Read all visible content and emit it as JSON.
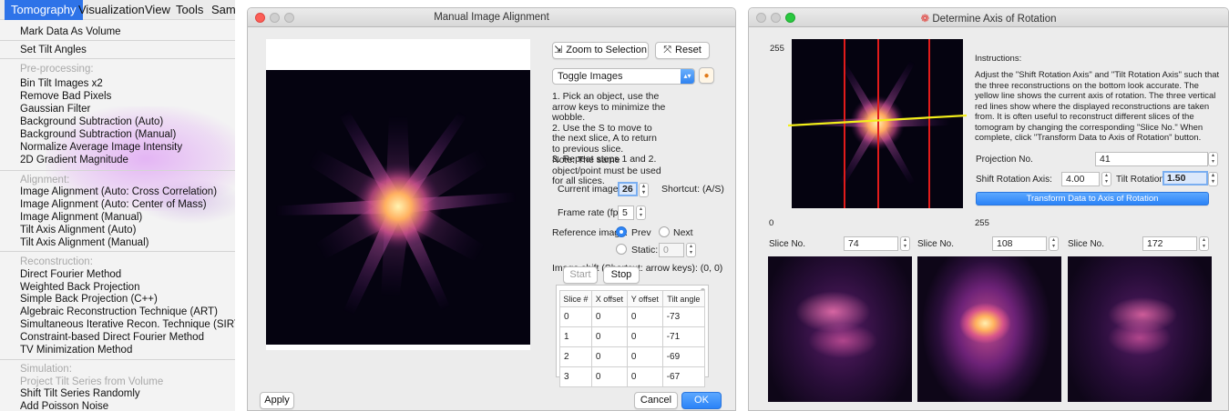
{
  "menu": {
    "menubar": [
      "Tomography",
      "Visualization",
      "View",
      "Tools",
      "Samp"
    ],
    "items": [
      {
        "label": "Mark Data As Volume",
        "type": "item"
      },
      {
        "label": "Set Tilt Angles",
        "type": "item"
      },
      {
        "label": "Pre-processing:",
        "type": "header"
      },
      {
        "label": "Bin Tilt Images x2",
        "type": "item"
      },
      {
        "label": "Remove Bad Pixels",
        "type": "item"
      },
      {
        "label": "Gaussian Filter",
        "type": "item"
      },
      {
        "label": "Background Subtraction (Auto)",
        "type": "item"
      },
      {
        "label": "Background Subtraction (Manual)",
        "type": "item"
      },
      {
        "label": "Normalize Average Image Intensity",
        "type": "item"
      },
      {
        "label": "2D Gradient Magnitude",
        "type": "item"
      },
      {
        "label": "Alignment:",
        "type": "header"
      },
      {
        "label": "Image Alignment (Auto: Cross Correlation)",
        "type": "item"
      },
      {
        "label": "Image Alignment (Auto: Center of Mass)",
        "type": "item"
      },
      {
        "label": "Image Alignment (Manual)",
        "type": "item"
      },
      {
        "label": "Tilt Axis Alignment (Auto)",
        "type": "item"
      },
      {
        "label": "Tilt Axis Alignment (Manual)",
        "type": "item"
      },
      {
        "label": "Reconstruction:",
        "type": "header"
      },
      {
        "label": "Direct Fourier Method",
        "type": "item"
      },
      {
        "label": "Weighted Back Projection",
        "type": "item"
      },
      {
        "label": "Simple Back Projection (C++)",
        "type": "item"
      },
      {
        "label": "Algebraic Reconstruction Technique (ART)",
        "type": "item"
      },
      {
        "label": "Simultaneous Iterative Recon. Technique (SIRT)",
        "type": "item"
      },
      {
        "label": "Constraint-based Direct Fourier Method",
        "type": "item"
      },
      {
        "label": "TV Minimization Method",
        "type": "item"
      },
      {
        "label": "Simulation:",
        "type": "header"
      },
      {
        "label": "Project Tilt Series from Volume",
        "type": "disabled"
      },
      {
        "label": "Shift Tilt Series Randomly",
        "type": "item"
      },
      {
        "label": "Add Poisson Noise",
        "type": "item"
      }
    ]
  },
  "align": {
    "title": "Manual Image Alignment",
    "zoom_label": "Zoom to Selection",
    "reset_label": "Reset",
    "toggle_option": "Toggle Images",
    "instructions": "1. Pick an object, use the arrow keys to minimize the wobble.\n2. Use the S to move to the next slice, A to return to previous slice.\n3. Repeat steps 1 and 2.",
    "note": "Note: The same object/point must be used for all slices.",
    "current_image_label": "Current image:",
    "current_image_value": "26",
    "shortcut": "Shortcut: (A/S)",
    "frame_rate_label": "Frame rate (fps):",
    "frame_rate_value": "5",
    "reference_label": "Reference image:",
    "prev_label": "Prev",
    "next_label": "Next",
    "static_label": "Static:",
    "static_value": "0",
    "shift_text": "Image shift (Shortcut: arrow keys): (0, 0)",
    "start_label": "Start",
    "stop_label": "Stop",
    "table_headers": [
      "Slice #",
      "X offset",
      "Y offset",
      "Tilt angle"
    ],
    "table_rows": [
      [
        "0",
        "0",
        "0",
        "-73"
      ],
      [
        "1",
        "0",
        "0",
        "-71"
      ],
      [
        "2",
        "0",
        "0",
        "-69"
      ],
      [
        "3",
        "0",
        "0",
        "-67"
      ]
    ],
    "apply_label": "Apply",
    "cancel_label": "Cancel",
    "ok_label": "OK"
  },
  "axis": {
    "title": "Determine Axis of Rotation",
    "y_top_label": "255",
    "x_left_label": "0",
    "x_right_label": "255",
    "instructions_title": "Instructions:",
    "instructions": "Adjust the \"Shift Rotation Axis\" and \"Tilt Rotation Axis\" such that the three reconstructions on the bottom look accurate. The yellow line shows the current axis of rotation. The three vertical red lines show where the displayed reconstructions are taken from. It is often useful to reconstruct different slices of the tomogram by changing the corresponding \"Slice No.\" When complete, click \"Transform Data to Axis of Rotation\" button.",
    "projection_label": "Projection No.",
    "projection_value": "41",
    "shift_label": "Shift Rotation Axis:",
    "shift_value": "4.00",
    "tilt_label": "Tilt Rotation Axis:",
    "tilt_value": "1.50",
    "transform_label": "Transform Data to Axis of Rotation",
    "slice_label": "Slice No.",
    "slices": [
      "74",
      "108",
      "172"
    ]
  },
  "colors": {
    "accent": "#2e73e8",
    "red_line": "#e21b1b",
    "yellow_line": "#f2ee1a",
    "image_bg": "#050310"
  }
}
